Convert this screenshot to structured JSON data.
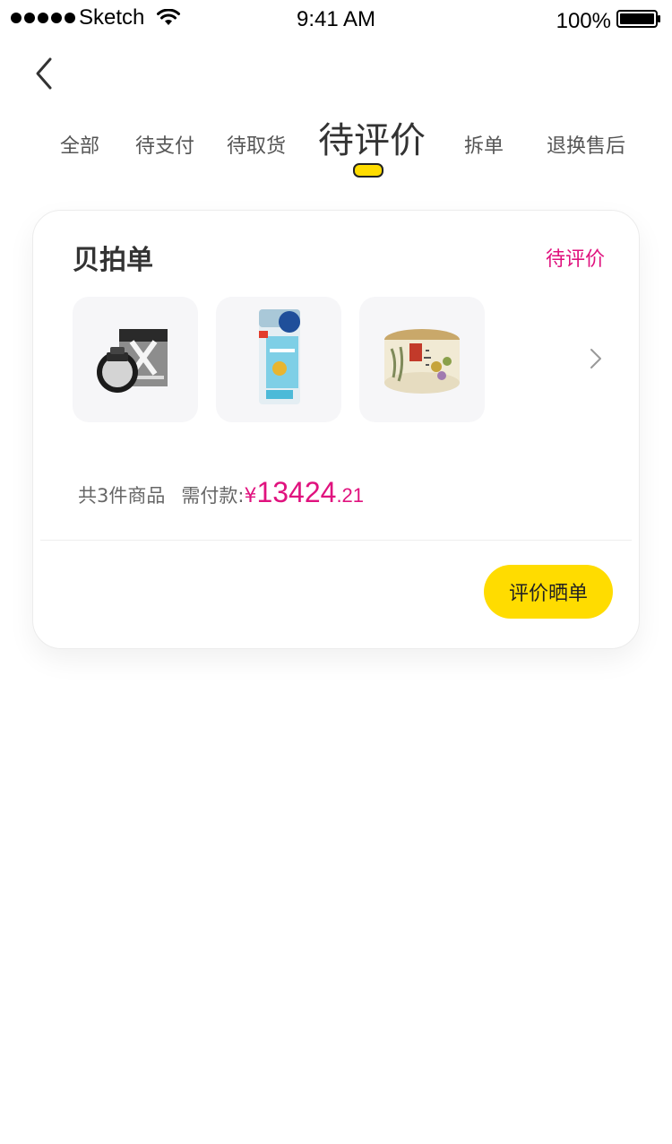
{
  "status_bar": {
    "carrier": "Sketch",
    "time": "9:41 AM",
    "battery": "100%"
  },
  "nav": {
    "back_icon": "chevron-left-icon",
    "tabs": [
      {
        "label": "全部",
        "active": false
      },
      {
        "label": "待支付",
        "active": false
      },
      {
        "label": "待取货",
        "active": false
      },
      {
        "label": "待评价",
        "active": true
      },
      {
        "label": "拆单",
        "active": false
      },
      {
        "label": "退换售后",
        "active": false
      }
    ]
  },
  "order": {
    "title": "贝拍单",
    "status": "待评价",
    "products": [
      {
        "name": "eye-drops-product-image"
      },
      {
        "name": "sunscreen-product-image"
      },
      {
        "name": "face-cream-product-image"
      }
    ],
    "summary": {
      "count_text": "共3件商品",
      "due_label": "需付款:",
      "price_symbol": "¥",
      "price_integer": "13424",
      "price_decimal": ".21"
    },
    "action_label": "评价晒单"
  },
  "colors": {
    "accent": "#FFDC00",
    "price": "#E0127E",
    "status": "#E0127E"
  }
}
